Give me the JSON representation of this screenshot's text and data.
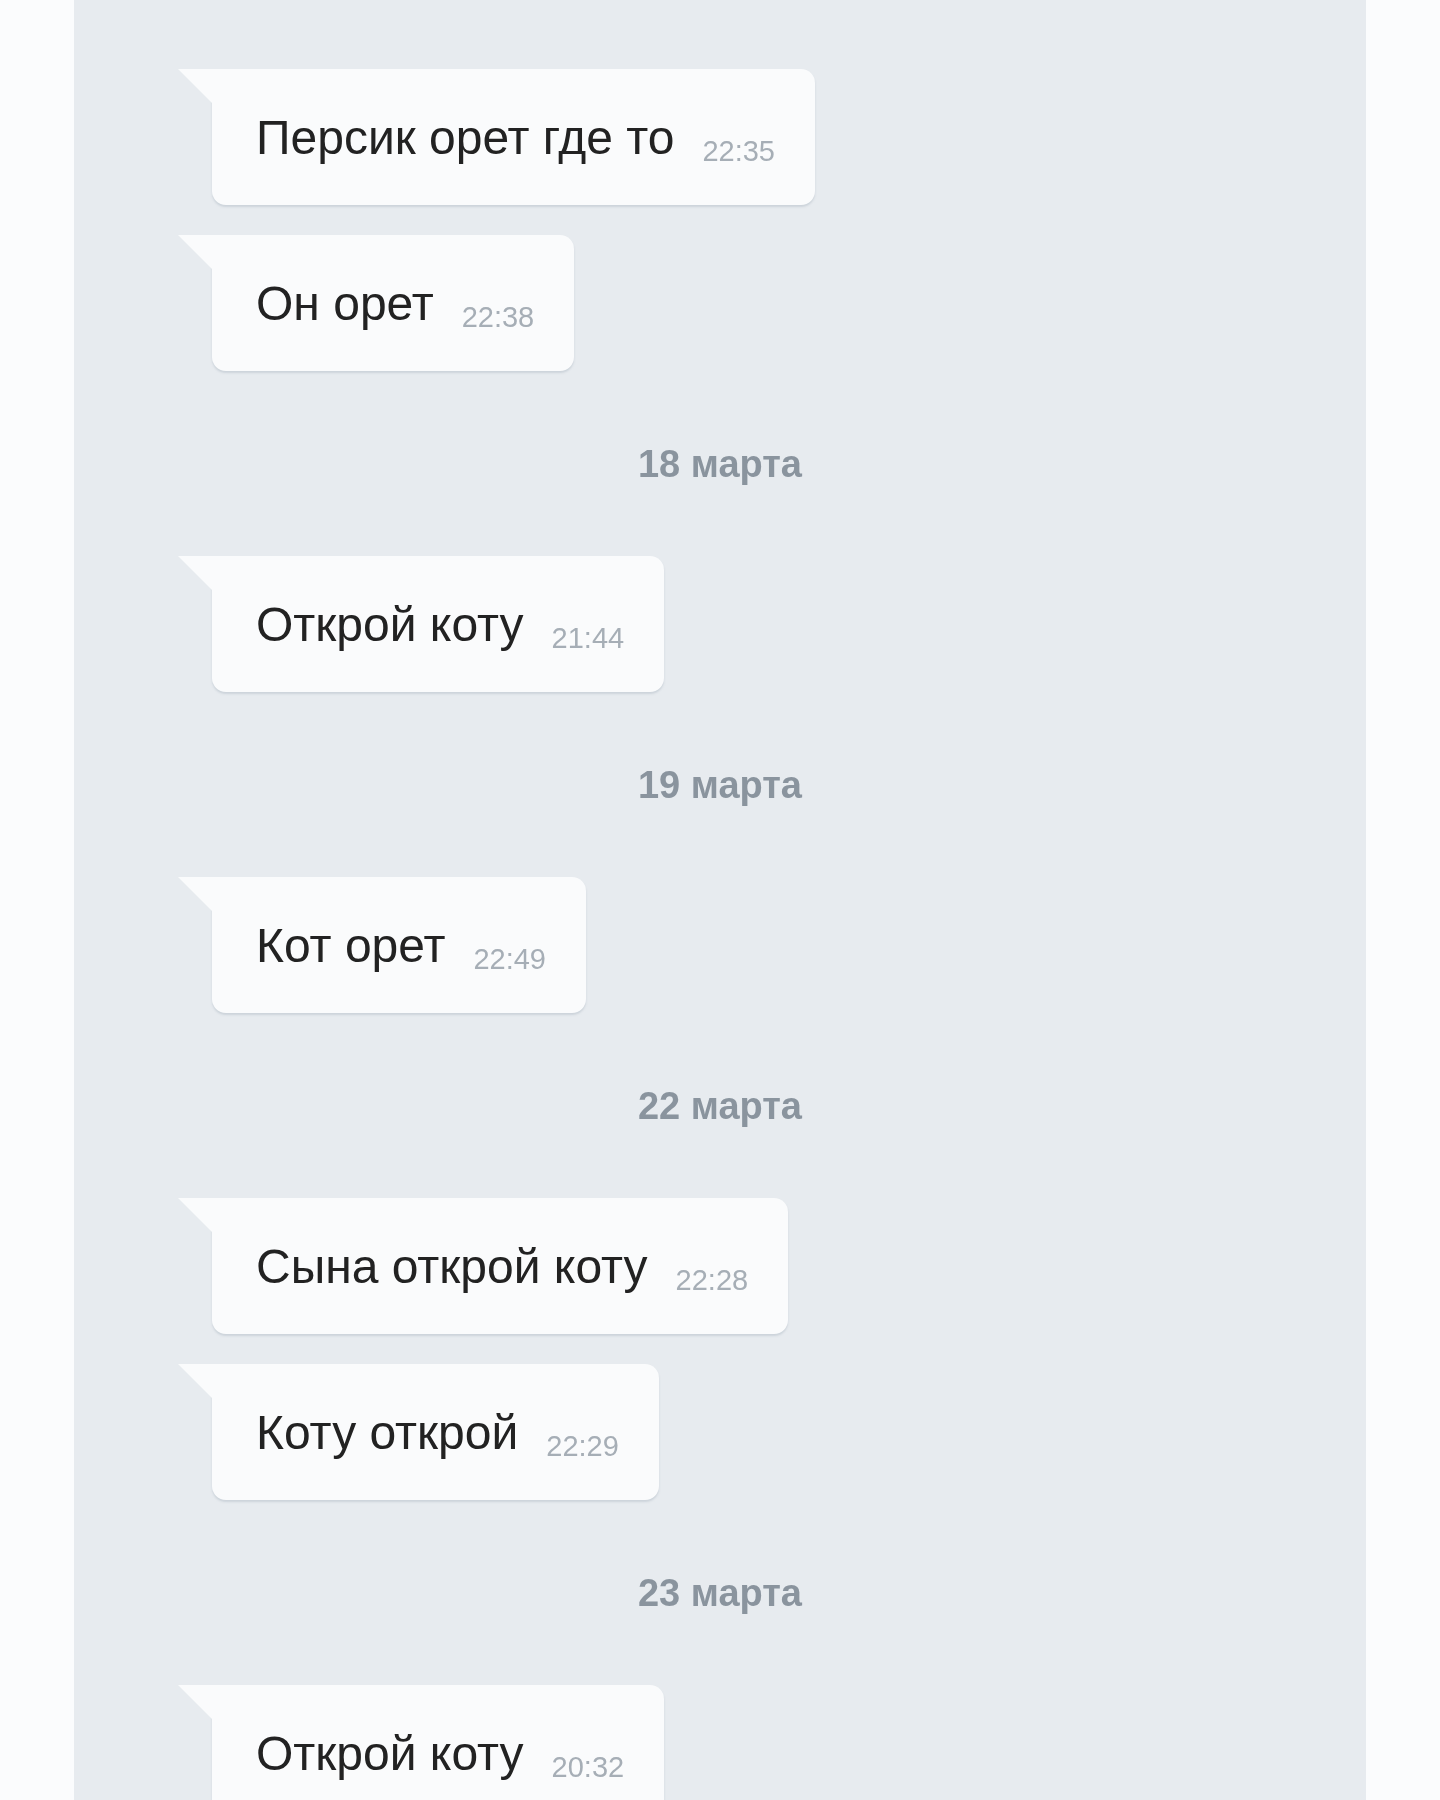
{
  "messages": [
    {
      "kind": "message",
      "text": "Персик орет где то",
      "time": "22:35"
    },
    {
      "kind": "message",
      "text": "Он орет",
      "time": "22:38"
    },
    {
      "kind": "date",
      "text": "18 марта"
    },
    {
      "kind": "message",
      "text": "Открой коту",
      "time": "21:44"
    },
    {
      "kind": "date",
      "text": "19 марта"
    },
    {
      "kind": "message",
      "text": "Кот орет",
      "time": "22:49"
    },
    {
      "kind": "date",
      "text": "22 марта"
    },
    {
      "kind": "message",
      "text": "Сына открой коту",
      "time": "22:28"
    },
    {
      "kind": "message",
      "text": "Коту открой",
      "time": "22:29"
    },
    {
      "kind": "date",
      "text": "23 марта"
    },
    {
      "kind": "message",
      "text": "Открой коту",
      "time": "20:32"
    }
  ]
}
